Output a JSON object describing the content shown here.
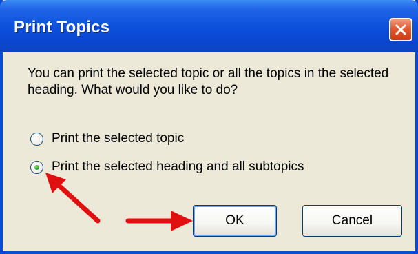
{
  "dialog": {
    "title": "Print Topics",
    "message": "You can print the selected topic or all the topics in the selected heading. What would you like to do?"
  },
  "options": [
    {
      "label": "Print the selected topic",
      "selected": false
    },
    {
      "label": "Print the selected heading and all subtopics",
      "selected": true
    }
  ],
  "buttons": {
    "ok_label": "OK",
    "cancel_label": "Cancel"
  },
  "icons": {
    "close": "close-icon",
    "annotation": "red-arrow-icon"
  },
  "colors": {
    "titlebar": "#0a4ad6",
    "close_button": "#d6461d",
    "annotation_arrow": "#e01010"
  }
}
